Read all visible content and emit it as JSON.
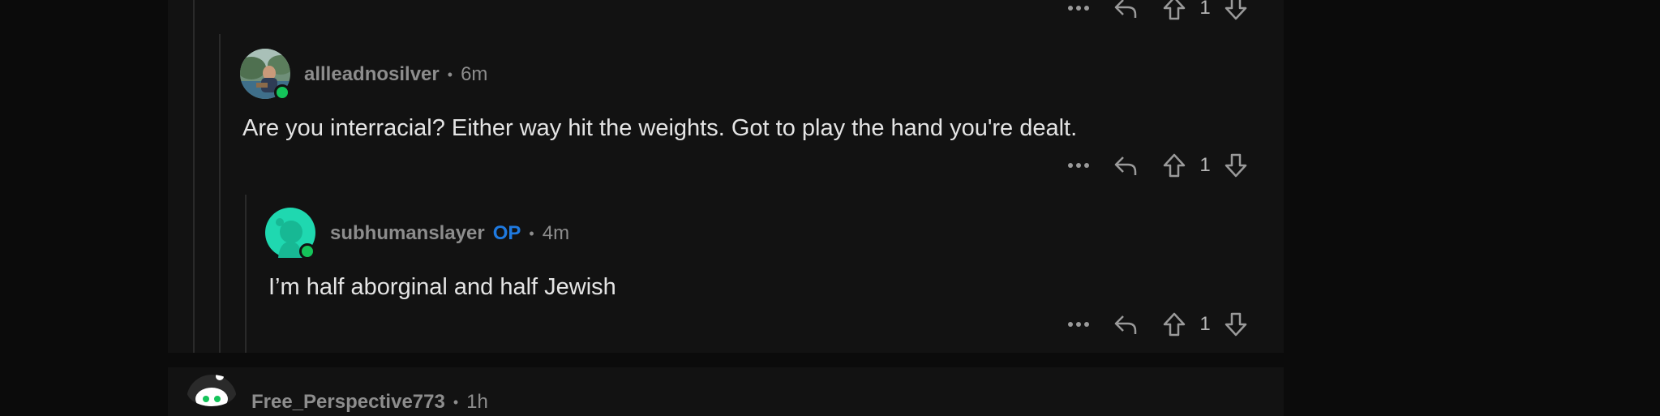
{
  "top_actions": {
    "score": "1"
  },
  "comments": [
    {
      "username": "allleadnosilver",
      "time": "6m",
      "body": "Are you interracial? Either way hit the weights. Got to play the hand you're dealt.",
      "score": "1",
      "op_badge": ""
    },
    {
      "username": "subhumanslayer",
      "op_badge": "OP",
      "time": "4m",
      "body": "I’m half aborginal and half Jewish",
      "score": "1"
    }
  ],
  "next_comment": {
    "username": "Free_Perspective773",
    "time": "1h"
  },
  "separator": "•",
  "icons": {
    "more": "more-icon",
    "reply": "reply-icon",
    "upvote": "upvote-icon",
    "downvote": "downvote-icon"
  },
  "colors": {
    "background": "#0b0b0b",
    "panel": "#121212",
    "text": "#e4e4e4",
    "meta": "#8d8d8d",
    "op": "#1f7ae0",
    "online": "#14c45a",
    "avatar_snoo": "#1fd8b0"
  }
}
